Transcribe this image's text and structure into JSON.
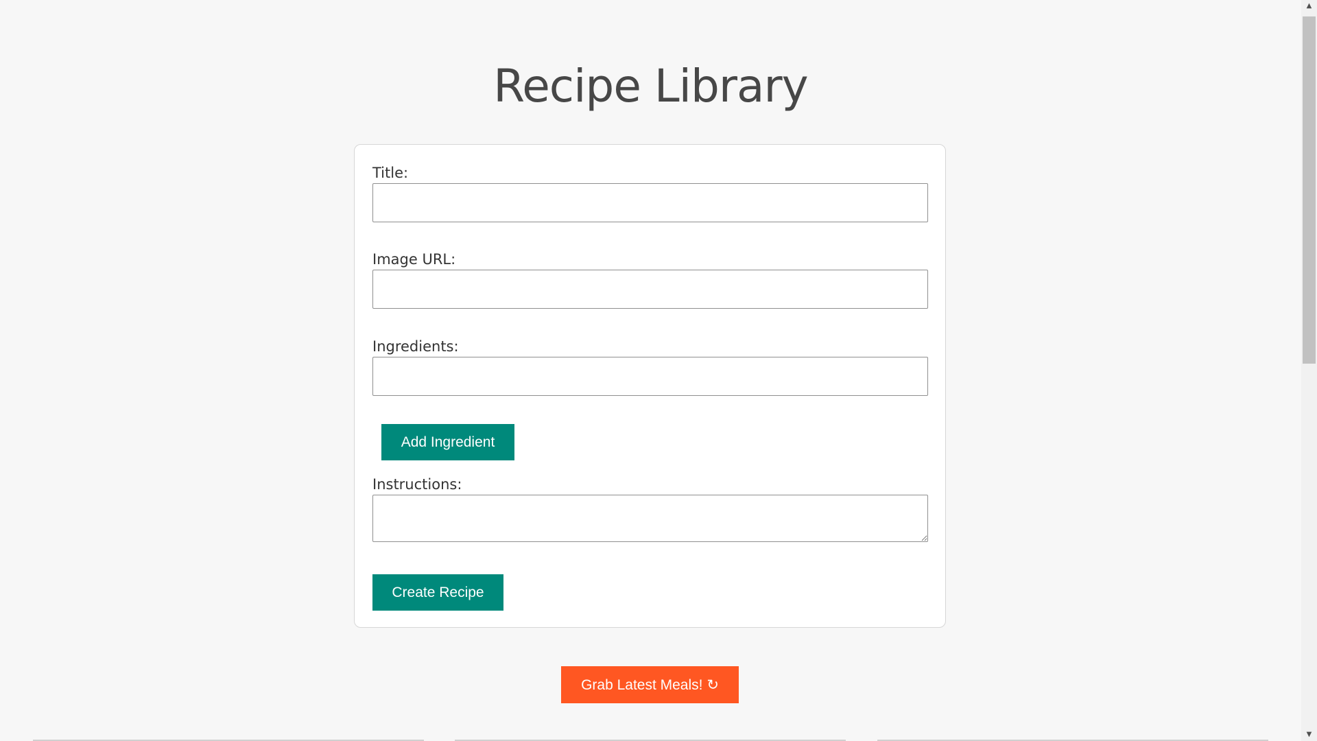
{
  "page": {
    "title": "Recipe Library"
  },
  "form": {
    "title_label": "Title:",
    "title_value": "",
    "image_url_label": "Image URL:",
    "image_url_value": "",
    "ingredients_label": "Ingredients:",
    "ingredient_value": "",
    "add_ingredient_label": "Add Ingredient",
    "instructions_label": "Instructions:",
    "instructions_value": "",
    "create_recipe_label": "Create Recipe"
  },
  "actions": {
    "grab_meals_label": "Grab Latest Meals! ↻"
  },
  "colors": {
    "accent": "#00897b",
    "secondary_accent": "#ff5722",
    "background": "#f7f7f7"
  },
  "icons": {
    "refresh": "refresh-icon",
    "scroll_up": "scroll-up-arrow-icon",
    "scroll_down": "scroll-down-arrow-icon"
  }
}
